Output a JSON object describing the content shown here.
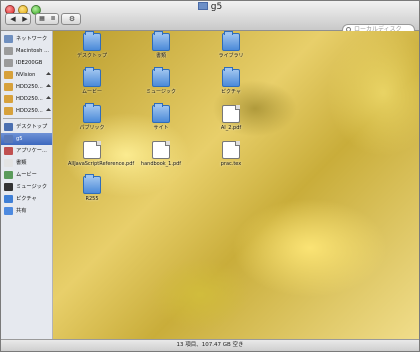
{
  "window": {
    "title": "g5"
  },
  "toolbar": {
    "back_label": "◀",
    "forward_label": "▶",
    "search_placeholder": "ローカルディスク"
  },
  "sidebar": {
    "items": [
      {
        "label": "ネットワーク",
        "icon": "globe-icon",
        "color": "#6f8fbf"
      },
      {
        "label": "Macintosh ...",
        "icon": "drive-icon",
        "color": "#9b9b9b"
      },
      {
        "label": "IDE200GB",
        "icon": "drive-icon",
        "color": "#9b9b9b"
      },
      {
        "label": "NVision",
        "icon": "drive-icon",
        "color": "#d7a13b",
        "eject": true
      },
      {
        "label": "HDD250...",
        "icon": "drive-icon",
        "color": "#d7a13b",
        "eject": true
      },
      {
        "label": "HDD250...",
        "icon": "drive-icon",
        "color": "#d7a13b",
        "eject": true
      },
      {
        "label": "HDD250...",
        "icon": "drive-icon",
        "color": "#d7a13b",
        "eject": true
      },
      {
        "label": "デスクトップ",
        "icon": "desktop-icon",
        "color": "#4b6fb0"
      },
      {
        "label": "g5",
        "icon": "home-icon",
        "color": "#5b7ab8",
        "selected": true
      },
      {
        "label": "アプリケー...",
        "icon": "applications-icon",
        "color": "#c05050"
      },
      {
        "label": "書類",
        "icon": "documents-icon",
        "color": "#e3e3e3"
      },
      {
        "label": "ムービー",
        "icon": "movies-icon",
        "color": "#5a9a5a"
      },
      {
        "label": "ミュージック",
        "icon": "music-icon",
        "color": "#333333"
      },
      {
        "label": "ピクチャ",
        "icon": "pictures-icon",
        "color": "#3f7fd6"
      },
      {
        "label": "共有",
        "icon": "shared-icon",
        "color": "#4d8ae0"
      }
    ]
  },
  "files": [
    {
      "name": "デスクトップ",
      "type": "folder",
      "icon": "desktop-folder-icon"
    },
    {
      "name": "書類",
      "type": "folder",
      "icon": "documents-folder-icon"
    },
    {
      "name": "ライブラリ",
      "type": "folder",
      "icon": "library-folder-icon"
    },
    {
      "name": "ムービー",
      "type": "folder",
      "icon": "movies-folder-icon"
    },
    {
      "name": "ミュージック",
      "type": "folder",
      "icon": "music-folder-icon"
    },
    {
      "name": "ピクチャ",
      "type": "folder",
      "icon": "pictures-folder-icon"
    },
    {
      "name": "パブリック",
      "type": "folder",
      "icon": "public-folder-icon"
    },
    {
      "name": "サイト",
      "type": "folder",
      "icon": "sites-folder-icon"
    },
    {
      "name": "AI_2.pdf",
      "type": "doc",
      "icon": "pdf-file-icon"
    },
    {
      "name": "AllJavaScriptReference.pdf",
      "type": "doc",
      "icon": "pdf-file-icon"
    },
    {
      "name": "handbook_1.pdf",
      "type": "doc",
      "icon": "pdf-file-icon"
    },
    {
      "name": "prac.tex",
      "type": "doc",
      "icon": "tex-file-icon"
    },
    {
      "name": "R255",
      "type": "folder",
      "icon": "folder-icon"
    }
  ],
  "statusbar": {
    "text": "13 項目、107.47 GB 空き"
  }
}
